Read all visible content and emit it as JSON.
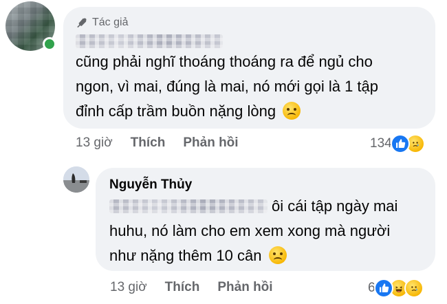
{
  "comment": {
    "author_badge": "Tác giả",
    "text_lines": [
      "cũng phải nghĩ thoáng thoáng ra để ngủ cho",
      "ngon, vì mai, đúng là mai, nó mới gọi là 1 tập",
      "đỉnh cấp trầm buồn nặng lòng"
    ],
    "time": "13 giờ",
    "like_label": "Thích",
    "reply_label": "Phản hồi",
    "reaction_count": "134",
    "reaction_icons": [
      "like-icon",
      "sad-face-icon"
    ]
  },
  "reply": {
    "author_name": "Nguyễn Thủy",
    "text_lines": [
      "ôi cái tập ngày mai",
      "huhu, nó làm cho em xem xong mà người",
      "như nặng thêm 10 cân"
    ],
    "time": "13 giờ",
    "like_label": "Thích",
    "reply_label": "Phản hồi",
    "reaction_count": "6",
    "reaction_icons": [
      "like-icon",
      "haha-face-icon",
      "sad-face-icon"
    ]
  },
  "colors": {
    "bubble_bg": "#f0f2f5",
    "secondary_text": "#65676b",
    "like_blue": "#1877f2",
    "online_green": "#31a24c"
  }
}
